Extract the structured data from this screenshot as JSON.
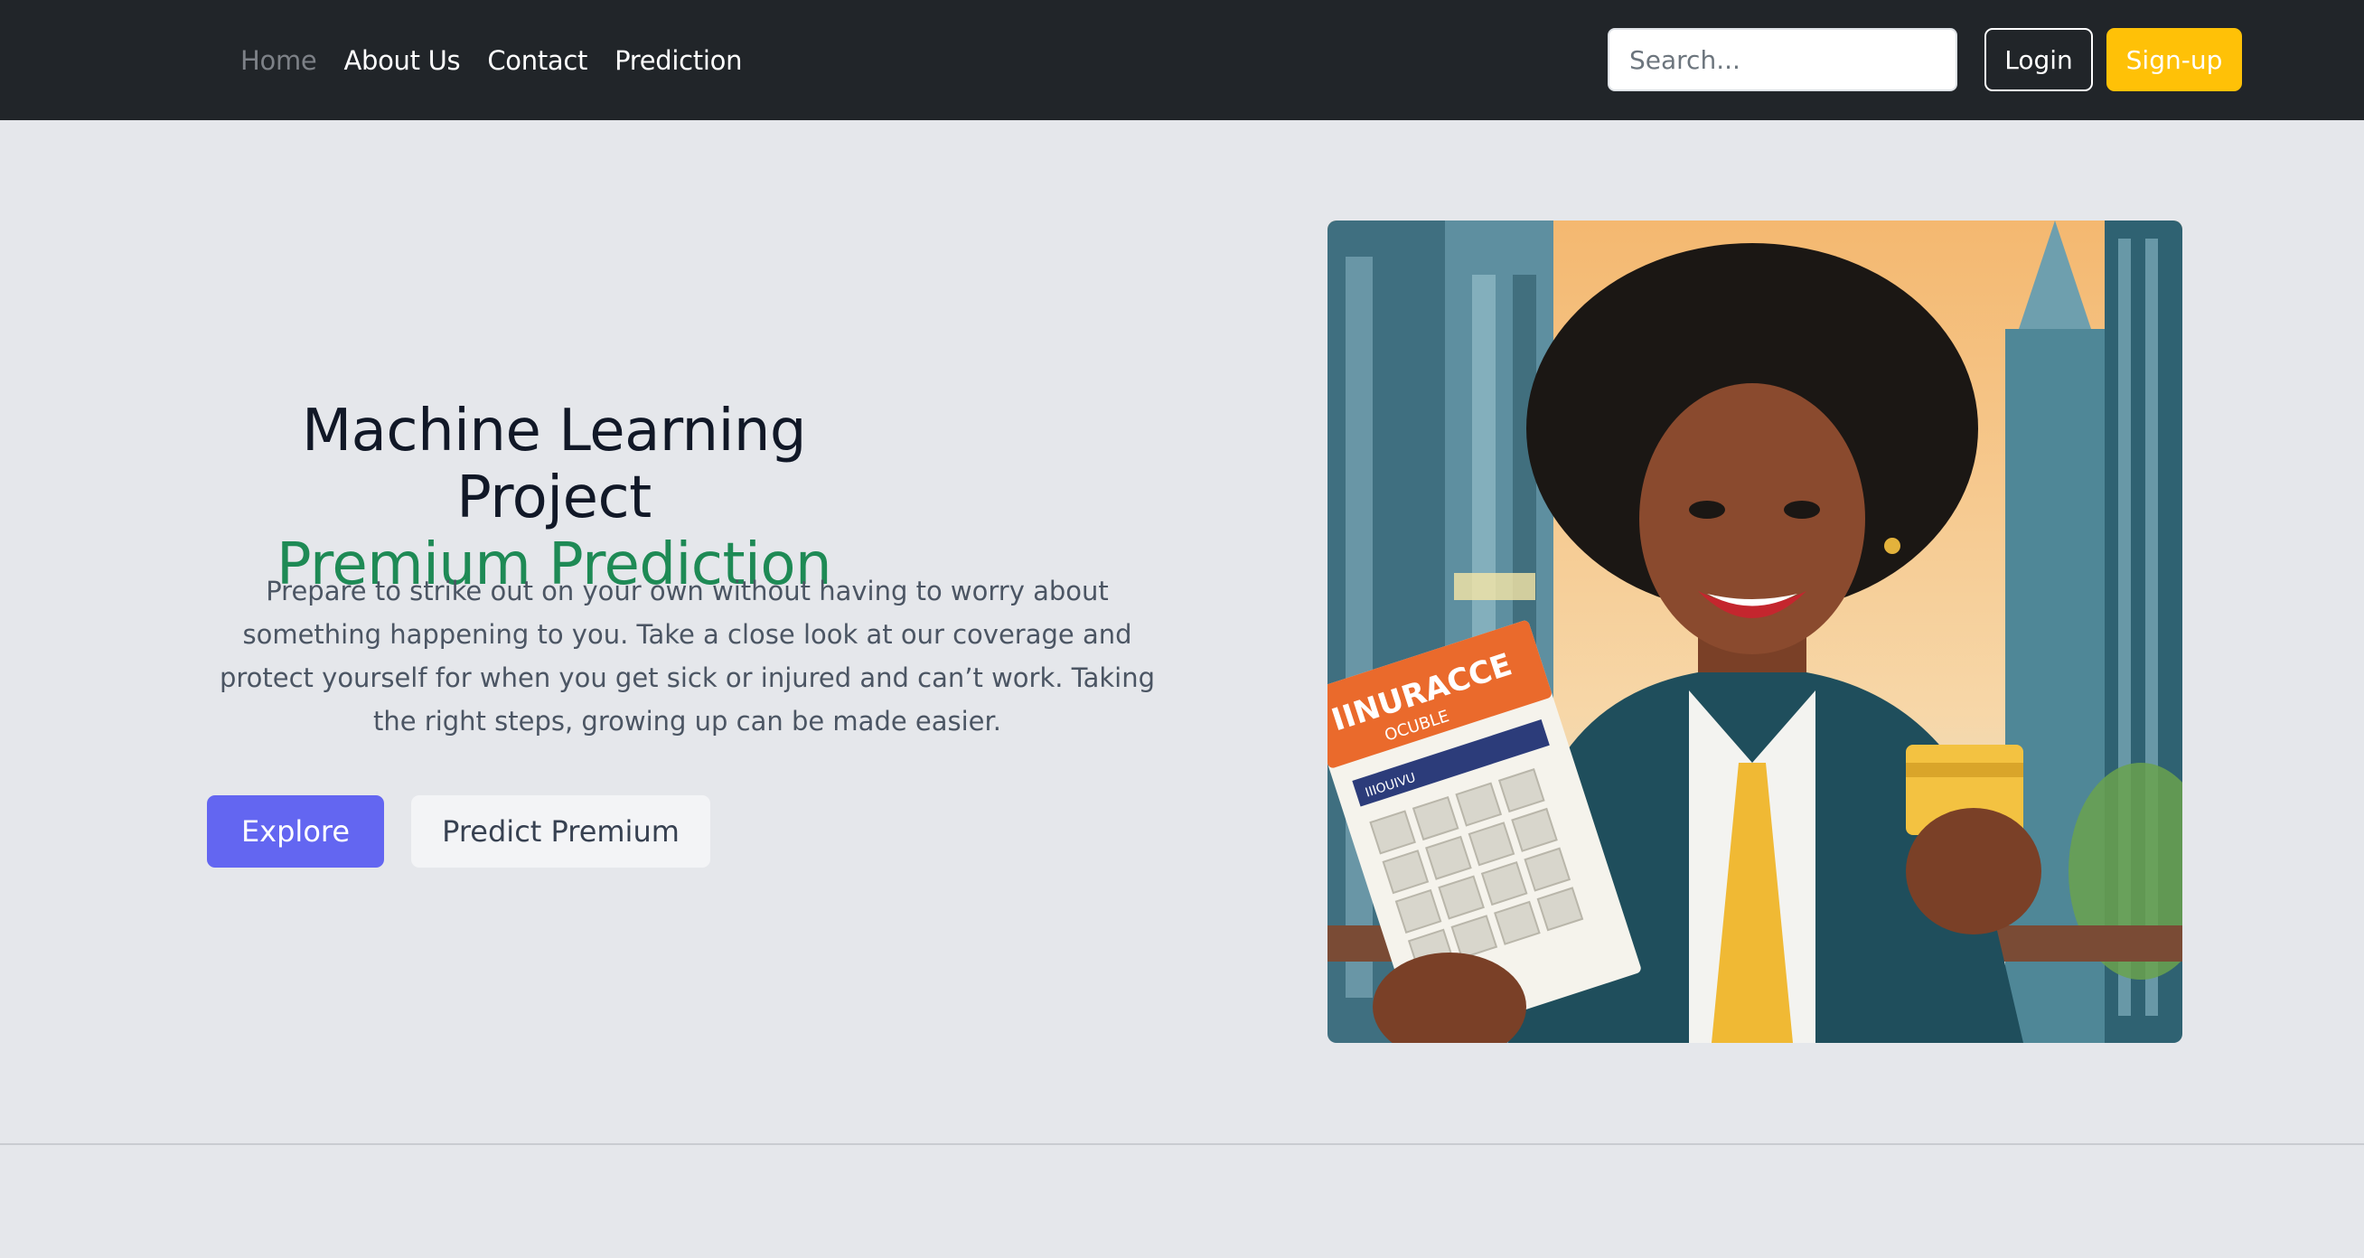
{
  "navbar": {
    "links": [
      "Home",
      "About Us",
      "Contact",
      "Prediction"
    ],
    "search_placeholder": "Search...",
    "login_label": "Login",
    "signup_label": "Sign-up"
  },
  "hero": {
    "title": "Machine Learning Project",
    "subtitle": "Premium Prediction",
    "description": "Prepare to strike out on your own without having to worry about something happening to you. Take a close look at our coverage and protect yourself for when you get sick or injured and can’t work. Taking the right steps, growing up can be made easier.",
    "explore_label": "Explore",
    "predict_label": "Predict Premium",
    "image": {
      "icon": "insurance-illustration",
      "sign_text": "IINURACCE",
      "sign_subtext": "OCUBLE",
      "form_text": "IIIOUIVU"
    }
  },
  "colors": {
    "navbar_bg": "#212529",
    "accent_yellow": "#ffc107",
    "accent_indigo": "#6366f1",
    "accent_green": "#1e8a55",
    "page_bg": "#e5e7eb"
  }
}
